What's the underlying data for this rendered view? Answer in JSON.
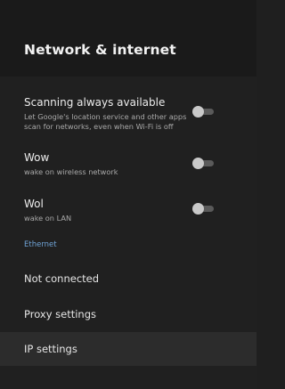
{
  "header": {
    "title": "Network & internet"
  },
  "toggles": [
    {
      "title": "Scanning always available",
      "subtitle": "Let Google's location service and other apps scan for networks, even when Wi-Fi is off",
      "enabled": false
    },
    {
      "title": "Wow",
      "subtitle": "wake on wireless network",
      "enabled": false
    },
    {
      "title": "Wol",
      "subtitle": "wake on LAN",
      "enabled": false
    }
  ],
  "ethernet": {
    "section_label": "Ethernet",
    "items": [
      {
        "label": "Not connected"
      },
      {
        "label": "Proxy settings"
      },
      {
        "label": "IP settings"
      }
    ]
  },
  "colors": {
    "accent": "#6fa3d6",
    "background": "#202020"
  }
}
